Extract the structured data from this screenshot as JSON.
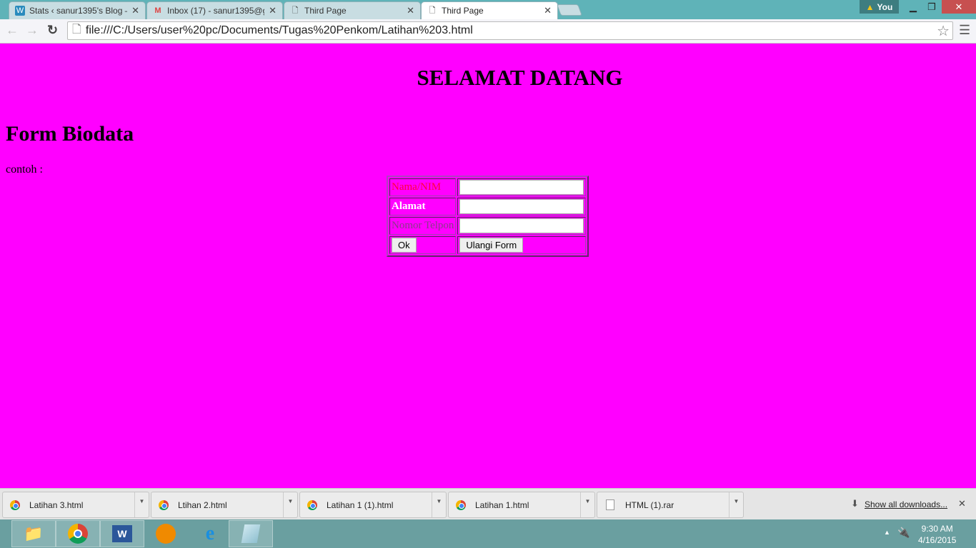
{
  "browser": {
    "tabs": [
      {
        "label": "Stats ‹ sanur1395's Blog –",
        "icon": "wordpress-icon",
        "active": false
      },
      {
        "label": "Inbox (17) - sanur1395@g",
        "icon": "gmail-icon",
        "active": false
      },
      {
        "label": "Third Page",
        "icon": "page-icon",
        "active": false
      },
      {
        "label": "Third Page",
        "icon": "page-icon",
        "active": true
      }
    ],
    "profile": "You",
    "url": "file:///C:/Users/user%20pc/Documents/Tugas%20Penkom/Latihan%203.html"
  },
  "page": {
    "background": "#ff00ff",
    "heading": "SELAMAT DATANG",
    "title": "Form Biodata",
    "caption": "contoh :",
    "form": {
      "fields": [
        {
          "label": "Nama/NIM",
          "value": "",
          "color": "#ff0040"
        },
        {
          "label": "Alamat",
          "value": "",
          "color": "#ffffff"
        },
        {
          "label": "Nomor Telpon",
          "value": "",
          "color": "#8a3a8a"
        }
      ],
      "submit": "Ok",
      "reset": "Ulangi Form"
    }
  },
  "downloads": {
    "items": [
      {
        "name": "Latihan 3.html",
        "icon": "chrome-icon"
      },
      {
        "name": "Ltihan 2.html",
        "icon": "chrome-icon"
      },
      {
        "name": "Latihan 1 (1).html",
        "icon": "chrome-icon"
      },
      {
        "name": "Latihan 1.html",
        "icon": "chrome-icon"
      },
      {
        "name": "HTML (1).rar",
        "icon": "file-icon"
      }
    ],
    "show_all": "Show all downloads..."
  },
  "taskbar": {
    "apps": [
      "file-explorer-icon",
      "chrome-icon",
      "word-icon",
      "gom-player-icon",
      "internet-explorer-icon",
      "notepad-icon"
    ],
    "time": "9:30 AM",
    "date": "4/16/2015"
  }
}
